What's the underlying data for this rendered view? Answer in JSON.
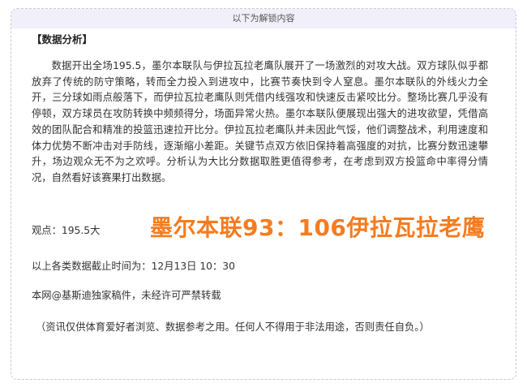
{
  "header": {
    "title": "以下为解锁内容"
  },
  "article": {
    "section_title": "【数据分析】",
    "paragraph": "数据开出全场195.5，墨尔本联队与伊拉瓦拉老鹰队展开了一场激烈的对攻大战。双方球队似乎都放弃了传统的防守策略，转而全力投入到进攻中，比赛节奏快到令人窒息。墨尔本联队的外线火力全开，三分球如雨点般落下，而伊拉瓦拉老鹰队则凭借内线强攻和快速反击紧咬比分。整场比赛几乎没有停顿，双方球员在攻防转换中频频得分，场面异常火热。墨尔本联队便展现出强大的进攻欲望，凭借高效的团队配合和精准的投篮迅速拉开比分。伊拉瓦拉老鹰队并未因此气馁，他们调整战术，利用速度和体力优势不断冲击对手防线，逐渐缩小差距。关键节点双方依旧保持着高强度的对抗，比赛分数迅速攀升，场边观众无不为之欢呼。分析认为大比分数据取胜更值得参考，在考虑到双方投篮命中率得分情况，自然看好该赛果打出数据。",
    "viewpoint": "观点：195.5大",
    "highlight": "墨尔本联93：106伊拉瓦拉老鹰",
    "cutoff": "以上各类数据截止时间为：12月13日 10：30",
    "copyright": "本网@基斯迪独家稿件，未经许可严禁转载",
    "disclaimer": "（资讯仅供体育爱好者浏览、数据参考之用。任何人不得用于非法用途，否则责任自负。）"
  },
  "colors": {
    "highlight": "#f47c20",
    "header_bg": "#f1eff9",
    "border": "#c9c9d3"
  }
}
